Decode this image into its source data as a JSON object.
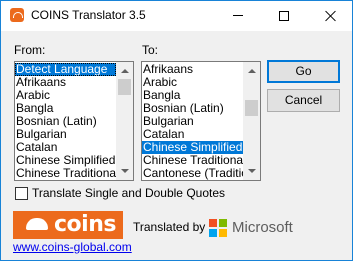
{
  "window": {
    "title": "COINS Translator 3.5"
  },
  "from": {
    "label": "From:",
    "items": [
      "Detect Language",
      "Afrikaans",
      "Arabic",
      "Bangla",
      "Bosnian (Latin)",
      "Bulgarian",
      "Catalan",
      "Chinese Simplified",
      "Chinese Traditional"
    ],
    "selected": "Detect Language"
  },
  "to": {
    "label": "To:",
    "items": [
      "Afrikaans",
      "Arabic",
      "Bangla",
      "Bosnian (Latin)",
      "Bulgarian",
      "Catalan",
      "Chinese Simplified",
      "Chinese Traditional",
      "Cantonese (Traditional"
    ],
    "selected": "Chinese Simplified"
  },
  "buttons": {
    "go": "Go",
    "cancel": "Cancel"
  },
  "options": {
    "quotes_label": "Translate Single and Double Quotes",
    "quotes_checked": false
  },
  "footer": {
    "coins_brand": "coins",
    "translated_by": "Translated by",
    "microsoft_brand": "Microsoft",
    "website": "www.coins-global.com"
  },
  "colors": {
    "accent": "#0078d7",
    "coins_orange": "#ec6a1c",
    "link": "#0000ee"
  }
}
